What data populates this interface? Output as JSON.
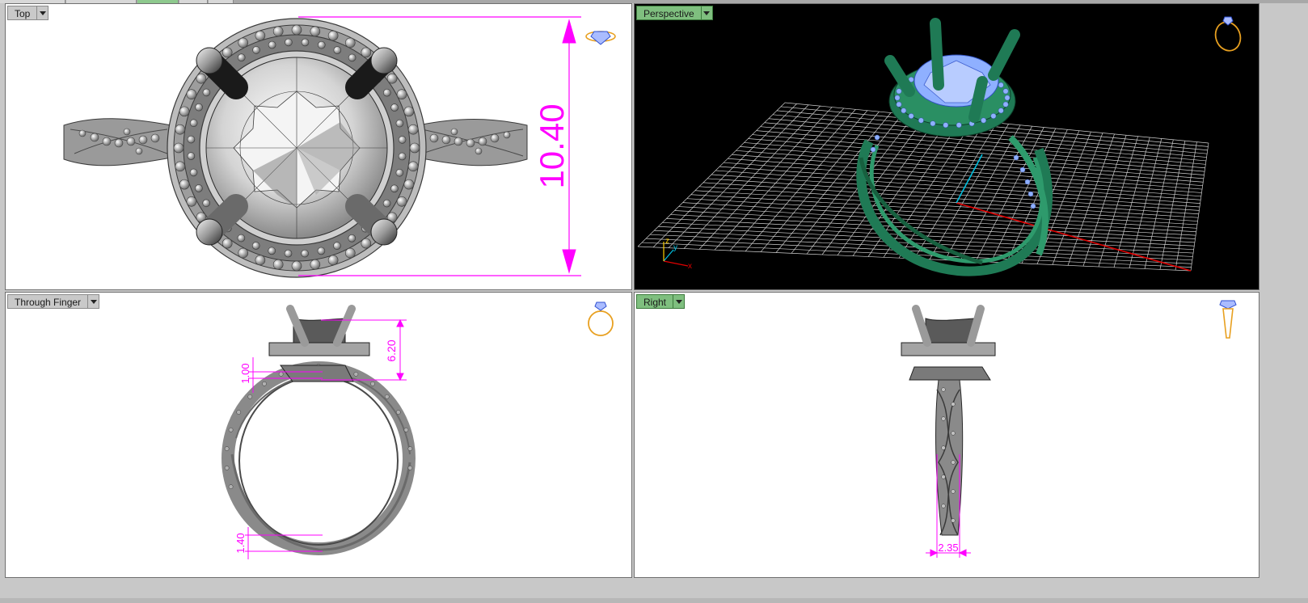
{
  "viewports": {
    "top": {
      "title": "Top",
      "dimension": "10.40"
    },
    "perspective": {
      "title": "Perspective",
      "axes": {
        "x": "x",
        "y": "y",
        "z": "z"
      }
    },
    "through_finger": {
      "title": "Through Finger",
      "dims": {
        "head": "6.20",
        "gap": "1.00",
        "shank": "1.40"
      }
    },
    "right": {
      "title": "Right",
      "dims": {
        "width": "2.35"
      }
    }
  },
  "colors": {
    "dimension": "#ff00ff",
    "active_tab": "#7fbf7f",
    "metal_perspective": "#1f7a55",
    "gem_perspective": "#8fb0ff",
    "icon_gold": "#e8a020",
    "icon_blue": "#4060e0",
    "background_perspective": "#000000",
    "grid": "#cfcfcf",
    "axis_x": "#e00000",
    "axis_y": "#00c0e0"
  },
  "icons": {
    "top": "ring-top-icon",
    "perspective": "ring-perspective-icon",
    "through_finger": "ring-front-icon",
    "right": "ring-side-icon"
  }
}
